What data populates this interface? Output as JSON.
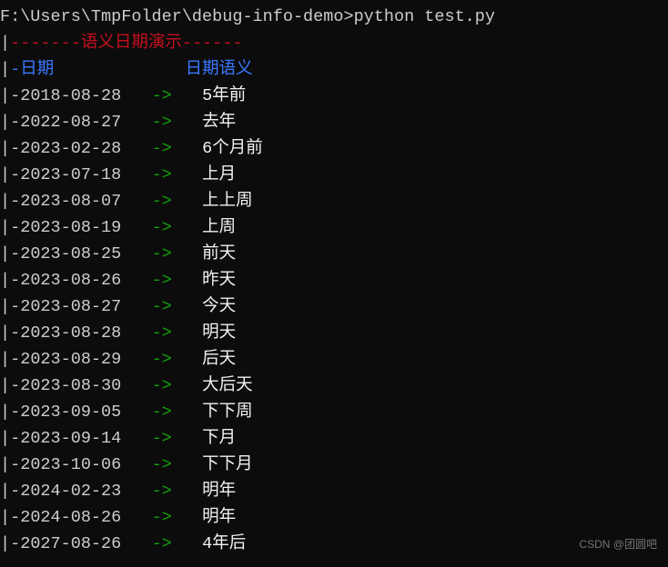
{
  "prompt": "F:\\Users\\TmpFolder\\debug-info-demo>python test.py",
  "title_prefix": "-------",
  "title_text": "语义日期演示",
  "title_suffix": "------",
  "header": {
    "col1": "日期",
    "col2": "日期语义"
  },
  "arrow": "->",
  "rows": [
    {
      "date": "2018-08-28",
      "semantic": "5年前"
    },
    {
      "date": "2022-08-27",
      "semantic": "去年"
    },
    {
      "date": "2023-02-28",
      "semantic": "6个月前"
    },
    {
      "date": "2023-07-18",
      "semantic": "上月"
    },
    {
      "date": "2023-08-07",
      "semantic": "上上周"
    },
    {
      "date": "2023-08-19",
      "semantic": "上周"
    },
    {
      "date": "2023-08-25",
      "semantic": "前天"
    },
    {
      "date": "2023-08-26",
      "semantic": "昨天"
    },
    {
      "date": "2023-08-27",
      "semantic": "今天"
    },
    {
      "date": "2023-08-28",
      "semantic": "明天"
    },
    {
      "date": "2023-08-29",
      "semantic": "后天"
    },
    {
      "date": "2023-08-30",
      "semantic": "大后天"
    },
    {
      "date": "2023-09-05",
      "semantic": "下下周"
    },
    {
      "date": "2023-09-14",
      "semantic": "下月"
    },
    {
      "date": "2023-10-06",
      "semantic": "下下月"
    },
    {
      "date": "2024-02-23",
      "semantic": "明年"
    },
    {
      "date": "2024-08-26",
      "semantic": "明年"
    },
    {
      "date": "2027-08-26",
      "semantic": "4年后"
    }
  ],
  "watermark": "CSDN @团圆吧"
}
